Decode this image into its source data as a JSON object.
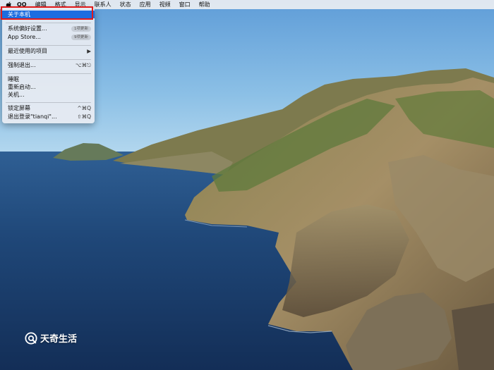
{
  "menubar": {
    "items": [
      {
        "label": "QQ",
        "bold": true
      },
      {
        "label": "编辑",
        "bold": false
      },
      {
        "label": "格式",
        "bold": false
      },
      {
        "label": "显示",
        "bold": false
      },
      {
        "label": "联系人",
        "bold": false
      },
      {
        "label": "状态",
        "bold": false
      },
      {
        "label": "应用",
        "bold": false
      },
      {
        "label": "视频",
        "bold": false
      },
      {
        "label": "窗口",
        "bold": false
      },
      {
        "label": "帮助",
        "bold": false
      }
    ]
  },
  "apple_menu": {
    "about": "关于本机",
    "system_prefs": "系统偏好设置...",
    "system_prefs_badge": "1项更新",
    "app_store": "App Store...",
    "app_store_badge": "9项更新",
    "recent_items": "最近使用的项目",
    "recent_items_arrow": "▶",
    "force_quit": "强制退出...",
    "force_quit_shortcut": "⌥⌘⎋",
    "sleep": "睡眠",
    "restart": "重新启动...",
    "shutdown": "关机...",
    "lock_screen": "锁定屏幕",
    "lock_screen_shortcut": "^⌘Q",
    "logout": "退出登录\"tianqi\"...",
    "logout_shortcut": "⇧⌘Q"
  },
  "highlight_color": "#e11a1a",
  "selection_color": "#1d6de0",
  "watermark": {
    "text": "天奇生活"
  }
}
